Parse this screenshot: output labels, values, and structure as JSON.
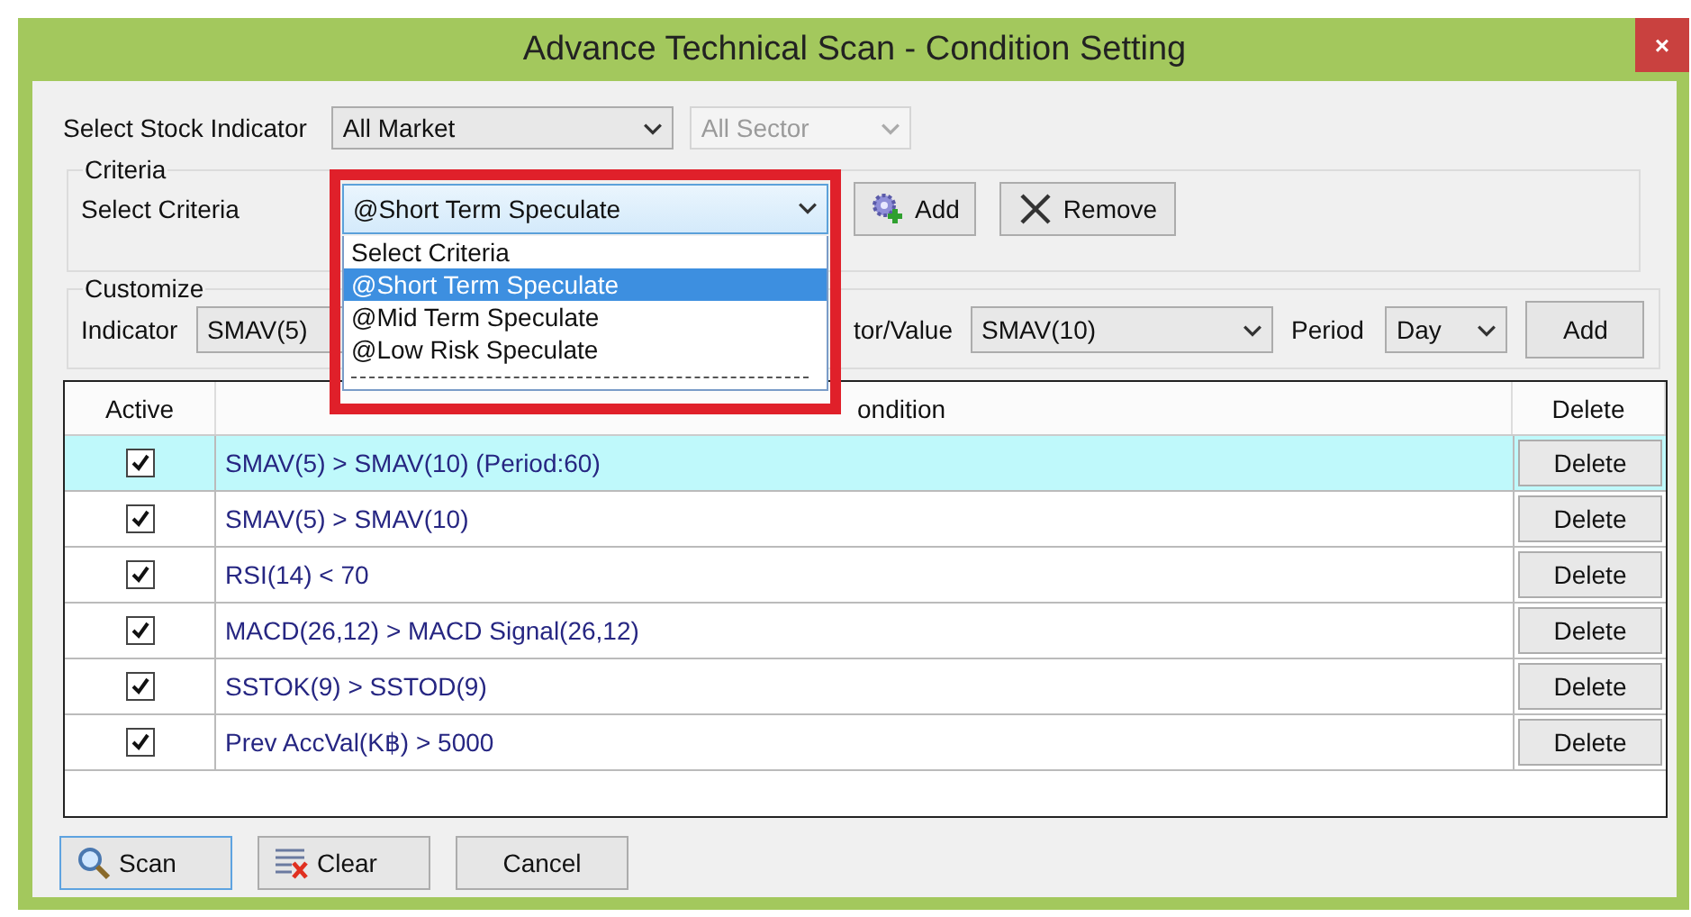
{
  "window": {
    "title": "Advance Technical Scan - Condition Setting",
    "close": "×"
  },
  "stock_indicator": {
    "label": "Select Stock Indicator",
    "market": "All Market",
    "sector": "All Sector",
    "sector_disabled": true
  },
  "criteria": {
    "group_label": "Criteria",
    "label": "Select Criteria",
    "value": "@Short Term Speculate",
    "expanded": true,
    "options": [
      {
        "kind": "option",
        "label": "Select Criteria",
        "selected": false
      },
      {
        "kind": "option",
        "label": "@Short Term Speculate",
        "selected": true
      },
      {
        "kind": "option",
        "label": "@Mid Term Speculate",
        "selected": false
      },
      {
        "kind": "option",
        "label": "@Low Risk Speculate",
        "selected": false
      },
      {
        "kind": "separator"
      }
    ],
    "add_button": "Add",
    "remove_button": "Remove"
  },
  "customize": {
    "group_label": "Customize",
    "indicator_label": "Indicator",
    "indicator_value": "SMAV(5)",
    "compare_label": "tor/Value",
    "compare_value": "SMAV(10)",
    "period_label": "Period",
    "period_value": "Day",
    "add_button": "Add"
  },
  "table": {
    "columns": [
      "Active",
      "ondition",
      "Delete"
    ],
    "rows": [
      {
        "active": true,
        "condition": "SMAV(5) > SMAV(10) (Period:60)",
        "delete": "Delete",
        "selected": true
      },
      {
        "active": true,
        "condition": "SMAV(5) > SMAV(10)",
        "delete": "Delete",
        "selected": false
      },
      {
        "active": true,
        "condition": "RSI(14) < 70",
        "delete": "Delete",
        "selected": false
      },
      {
        "active": true,
        "condition": "MACD(26,12) > MACD Signal(26,12)",
        "delete": "Delete",
        "selected": false
      },
      {
        "active": true,
        "condition": "SSTOK(9) > SSTOD(9)",
        "delete": "Delete",
        "selected": false
      },
      {
        "active": true,
        "condition": "Prev AccVal(K฿) > 5000",
        "delete": "Delete",
        "selected": false
      }
    ]
  },
  "buttons": [
    {
      "kind": "scan",
      "label": "Scan",
      "focused": true
    },
    {
      "kind": "clear",
      "label": "Clear",
      "focused": false
    },
    {
      "kind": "cancel",
      "label": "Cancel",
      "focused": false
    }
  ]
}
